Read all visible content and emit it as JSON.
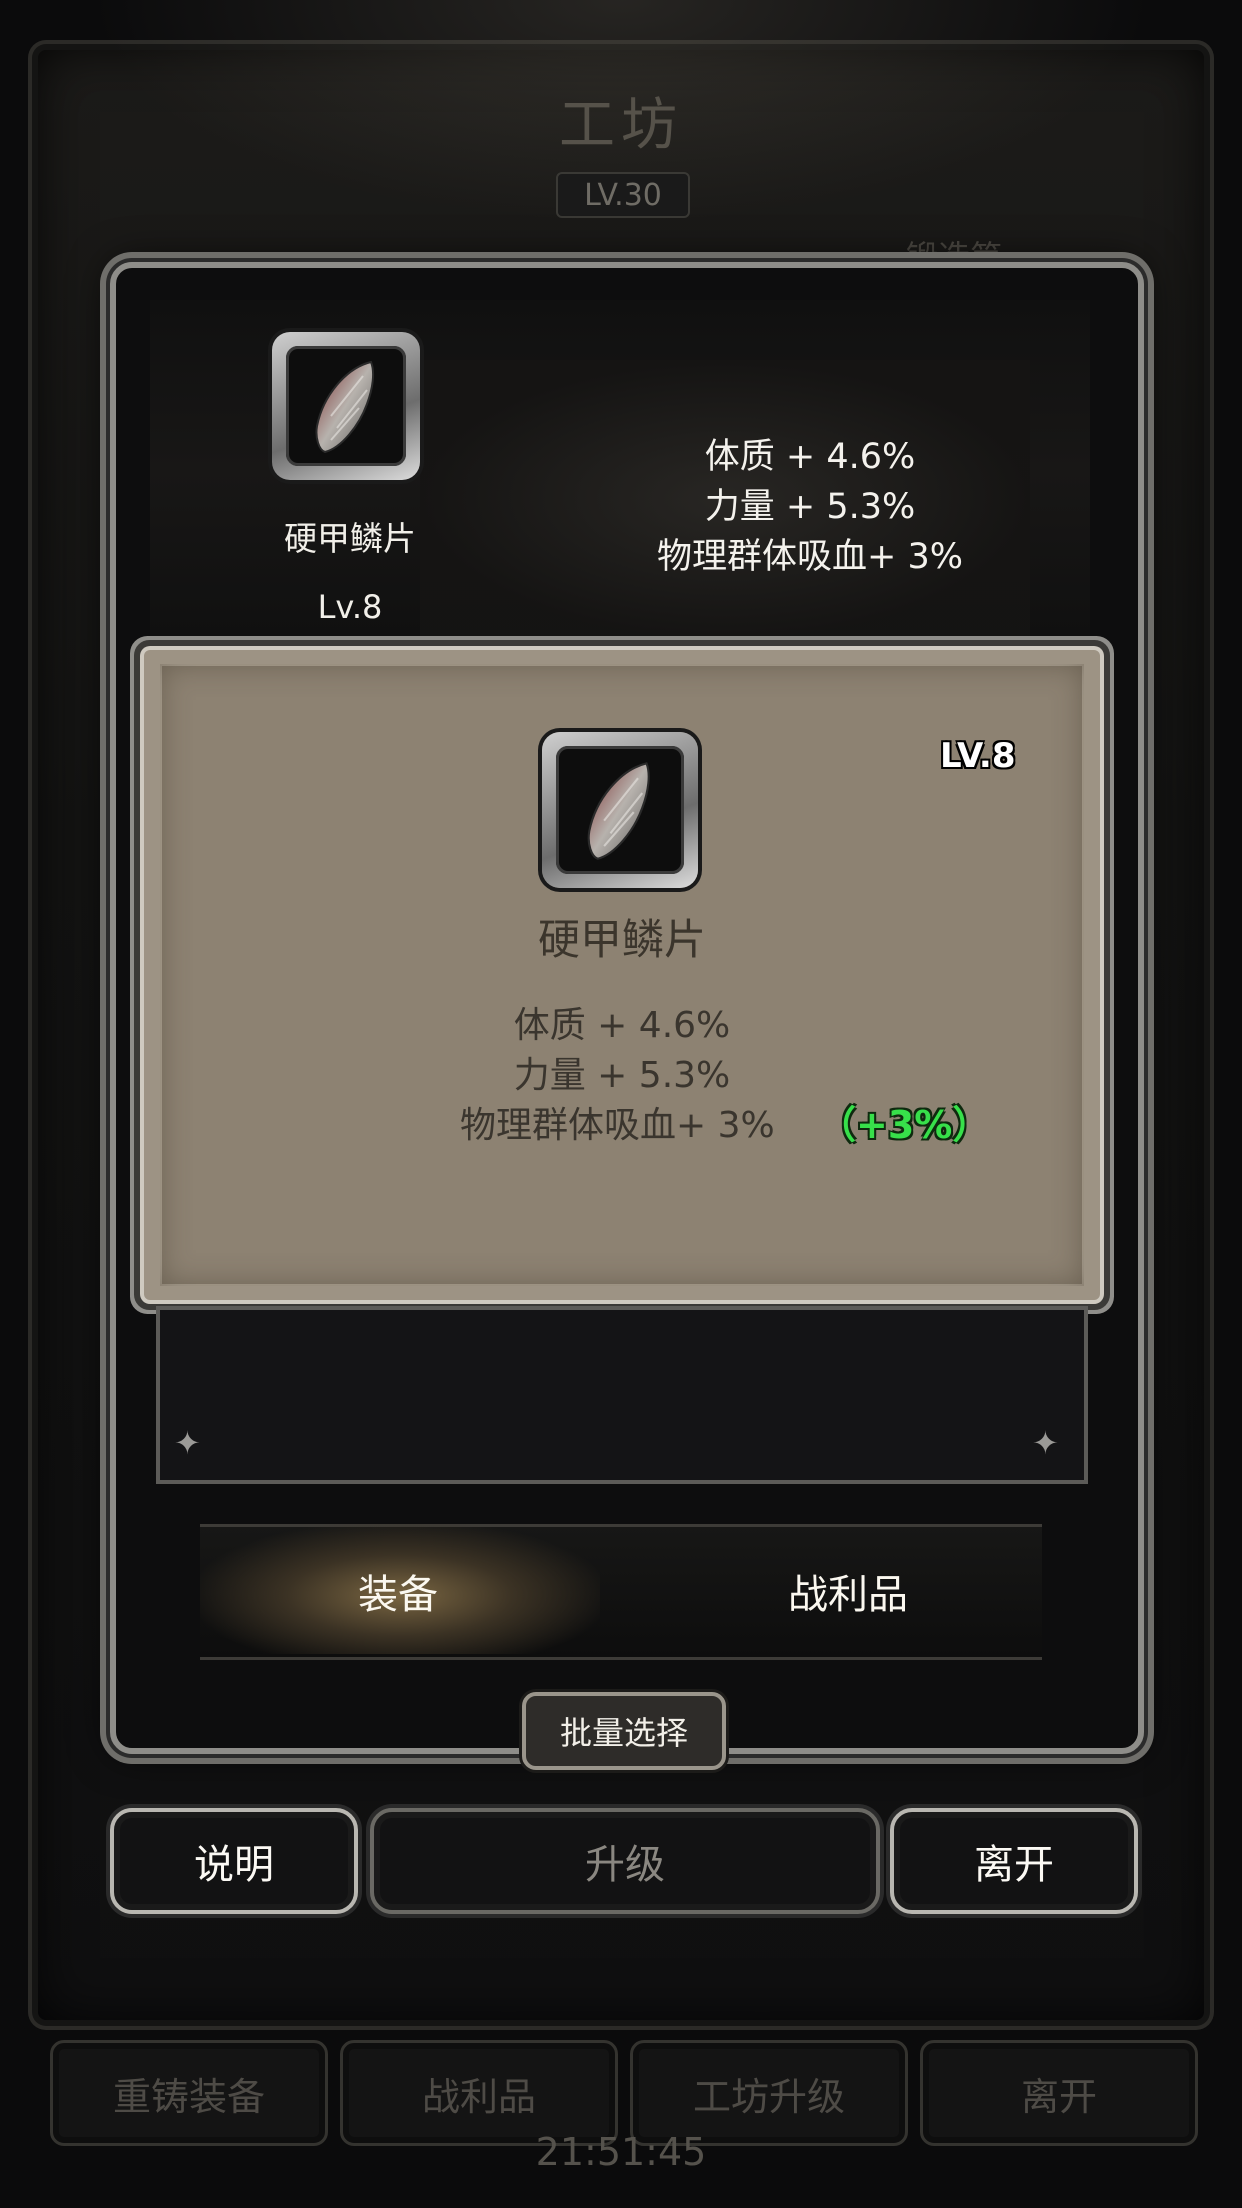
{
  "background": {
    "title": "工坊",
    "level": "LV.30",
    "tab_hint": "锻造第",
    "buttons": [
      "重铸装备",
      "战利品",
      "工坊升级",
      "离开"
    ],
    "time": "21:51:45"
  },
  "selected_item": {
    "name": "硬甲鳞片",
    "level": "Lv.8",
    "icon": "scale-armor-icon",
    "stats": [
      "体质 + 4.6%",
      "力量 + 5.3%",
      "物理群体吸血+ 3%"
    ]
  },
  "preview_card": {
    "level": "LV.8",
    "name": "硬甲鳞片",
    "stats": [
      "体质 + 4.6%",
      "力量 + 5.3%",
      "物理群体吸血+ 3%"
    ],
    "bonus": "（+3%）",
    "bonus_color": "#37e04a"
  },
  "tabs": [
    "装备",
    "战利品"
  ],
  "active_tab": "装备",
  "batch_select_label": "批量选择",
  "actions": {
    "help": "说明",
    "upgrade": "升级",
    "leave": "离开"
  }
}
